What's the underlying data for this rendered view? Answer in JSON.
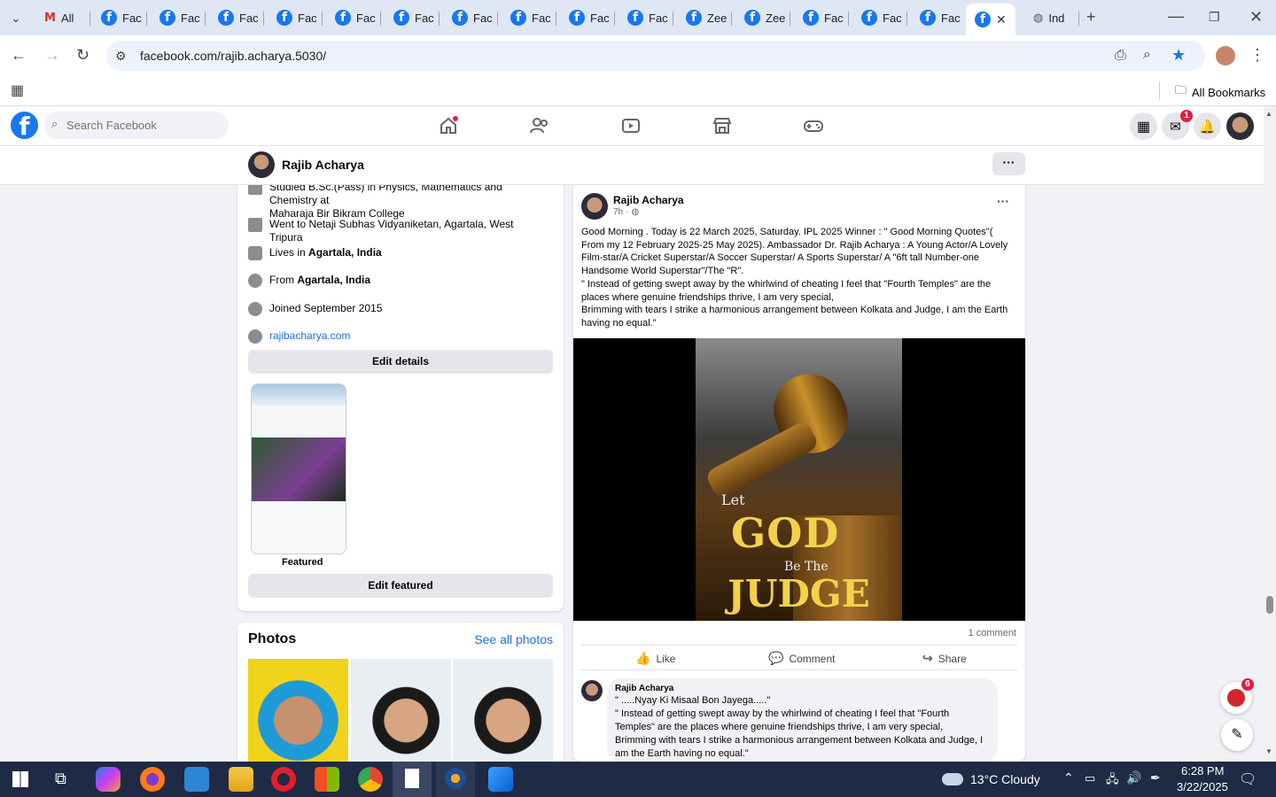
{
  "browser": {
    "tabs": [
      {
        "label": "All",
        "icon": "gmail-icon"
      },
      {
        "label": "Fac",
        "icon": "facebook-icon"
      },
      {
        "label": "Fac",
        "icon": "facebook-icon"
      },
      {
        "label": "Fac",
        "icon": "facebook-icon"
      },
      {
        "label": "Fac",
        "icon": "facebook-icon"
      },
      {
        "label": "Fac",
        "icon": "facebook-icon"
      },
      {
        "label": "Fac",
        "icon": "facebook-icon"
      },
      {
        "label": "Fac",
        "icon": "facebook-icon"
      },
      {
        "label": "Fac",
        "icon": "facebook-icon"
      },
      {
        "label": "Fac",
        "icon": "facebook-icon"
      },
      {
        "label": "Zee",
        "icon": "facebook-icon"
      },
      {
        "label": "Zee",
        "icon": "facebook-icon"
      },
      {
        "label": "Fac",
        "icon": "facebook-icon"
      },
      {
        "label": "Fac",
        "icon": "facebook-icon"
      },
      {
        "label": "Fac",
        "icon": "facebook-icon"
      },
      {
        "label": "",
        "icon": "facebook-icon"
      },
      {
        "label": "Ind",
        "icon": "globe-icon"
      }
    ],
    "url": "facebook.com/rajib.acharya.5030/",
    "bookmarks_label": "All Bookmarks"
  },
  "fb": {
    "search_placeholder": "Search Facebook",
    "messenger_badge": "1",
    "profile_name": "Rajib Acharya",
    "more_label": "···"
  },
  "intro": {
    "studied_text": "Studied B.Sc.(Pass) in Physics, Mathematics and Chemistry at",
    "studied_school": "Maharaja Bir Bikram College",
    "went_to": "Went to Netaji Subhas Vidyaniketan, Agartala, West Tripura",
    "lives_prefix": "Lives in",
    "lives_place": "Agartala, India",
    "from_prefix": "From",
    "from_place": "Agartala, India",
    "joined": "Joined September 2015",
    "website": "rajibacharya.com",
    "edit_details": "Edit details",
    "featured_label": "Featured",
    "edit_featured": "Edit featured"
  },
  "photos": {
    "title": "Photos",
    "see_all": "See all photos"
  },
  "post": {
    "author": "Rajib Acharya",
    "time": "7h",
    "time_sep": "·",
    "text": "Good Morning . Today is 22 March 2025, Saturday. IPL 2025 Winner : \" Good Morning Quotes\"(\nFrom my 12 February 2025-25 May 2025). Ambassador Dr. Rajib Acharya : A Young Actor/A Lovely\nFilm-star/A Cricket Superstar/A Soccer Superstar/ A Sports Superstar/ A \"6ft tall Number-one\nHandsome World Superstar\"/The \"R\".\n\" Instead of getting swept away by the whirlwind of cheating I feel that \"Fourth Temples\" are the\nplaces where genuine friendships thrive, I am very special,\nBrimming with tears I strike a harmonious arrangement between Kolkata and Judge, I am the Earth\nhaving no equal.\"",
    "image_text_let": "Let",
    "image_text_god": "GOD",
    "image_text_be": "Be The",
    "image_text_judge": "JUDGE",
    "comment_count": "1 comment",
    "like": "Like",
    "comment": "Comment",
    "share": "Share",
    "comment_author": "Rajib Acharya",
    "comment_text": "\" .....Nyay Ki Misaal Bon Jayega.....\"\n\" Instead of getting swept away by the whirlwind of cheating I feel that \"Fourth\nTemples\" are the places where genuine friendships thrive, I am very special,\nBrimming with tears I strike a harmonious arrangement between Kolkata and Judge, I\nam the Earth having no equal.\""
  },
  "widgets": {
    "chat_badge": "6"
  },
  "taskbar": {
    "weather": "13°C  Cloudy",
    "time": "6:28 PM",
    "date": "3/22/2025"
  },
  "colors": {
    "fb_blue": "#1877f2",
    "badge_red": "#e41e3f",
    "taskbar": "#1f2a44"
  }
}
